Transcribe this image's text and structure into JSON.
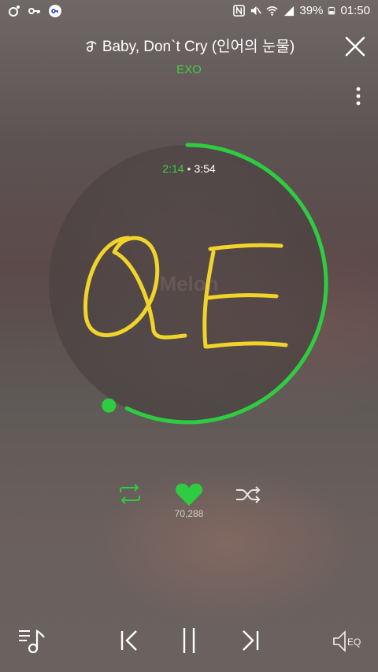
{
  "status_bar": {
    "battery": "39%",
    "time": "01:50",
    "icons": [
      "melon-status-icon",
      "key-icon",
      "vpn-icon",
      "nfc-icon",
      "mute-icon",
      "wifi-icon",
      "signal-icon",
      "battery-icon"
    ]
  },
  "header": {
    "title": "Baby, Don`t Cry (인어의 눈물)",
    "artist": "EXO"
  },
  "player": {
    "current_time": "2:14",
    "separator": "•",
    "total_time": "3:54",
    "progress_fraction": 0.572,
    "like_count": "70,288",
    "watermark": "Melon"
  },
  "colors": {
    "accent": "#2ecc40",
    "art_stroke": "#f1d42a"
  }
}
